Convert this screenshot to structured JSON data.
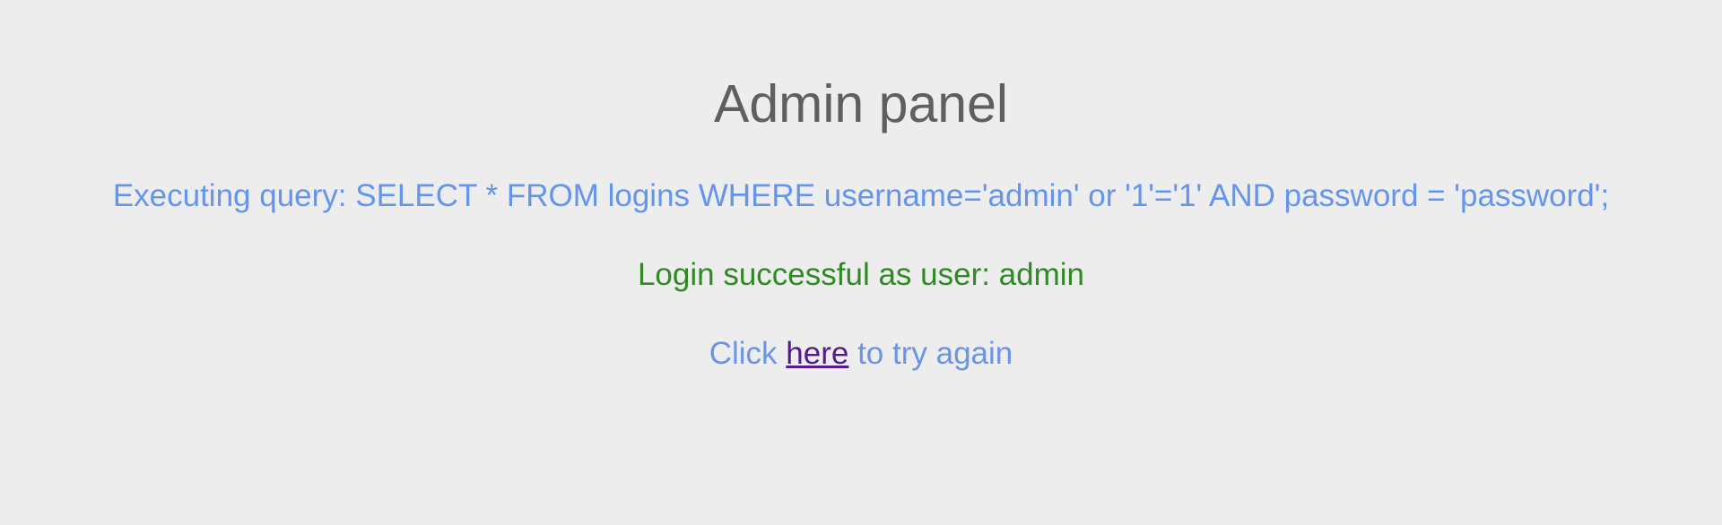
{
  "page": {
    "title": "Admin panel",
    "query_message": "Executing query: SELECT * FROM logins WHERE username='admin' or '1'='1' AND password = 'password';",
    "success_message": "Login successful as user: admin",
    "retry": {
      "prefix": "Click ",
      "link_text": "here",
      "suffix": " to try again"
    }
  },
  "colors": {
    "background": "#ededed",
    "title": "#5f5f5f",
    "query": "#6495ed",
    "success": "#2e8b23",
    "link_visited": "#551a8b"
  }
}
